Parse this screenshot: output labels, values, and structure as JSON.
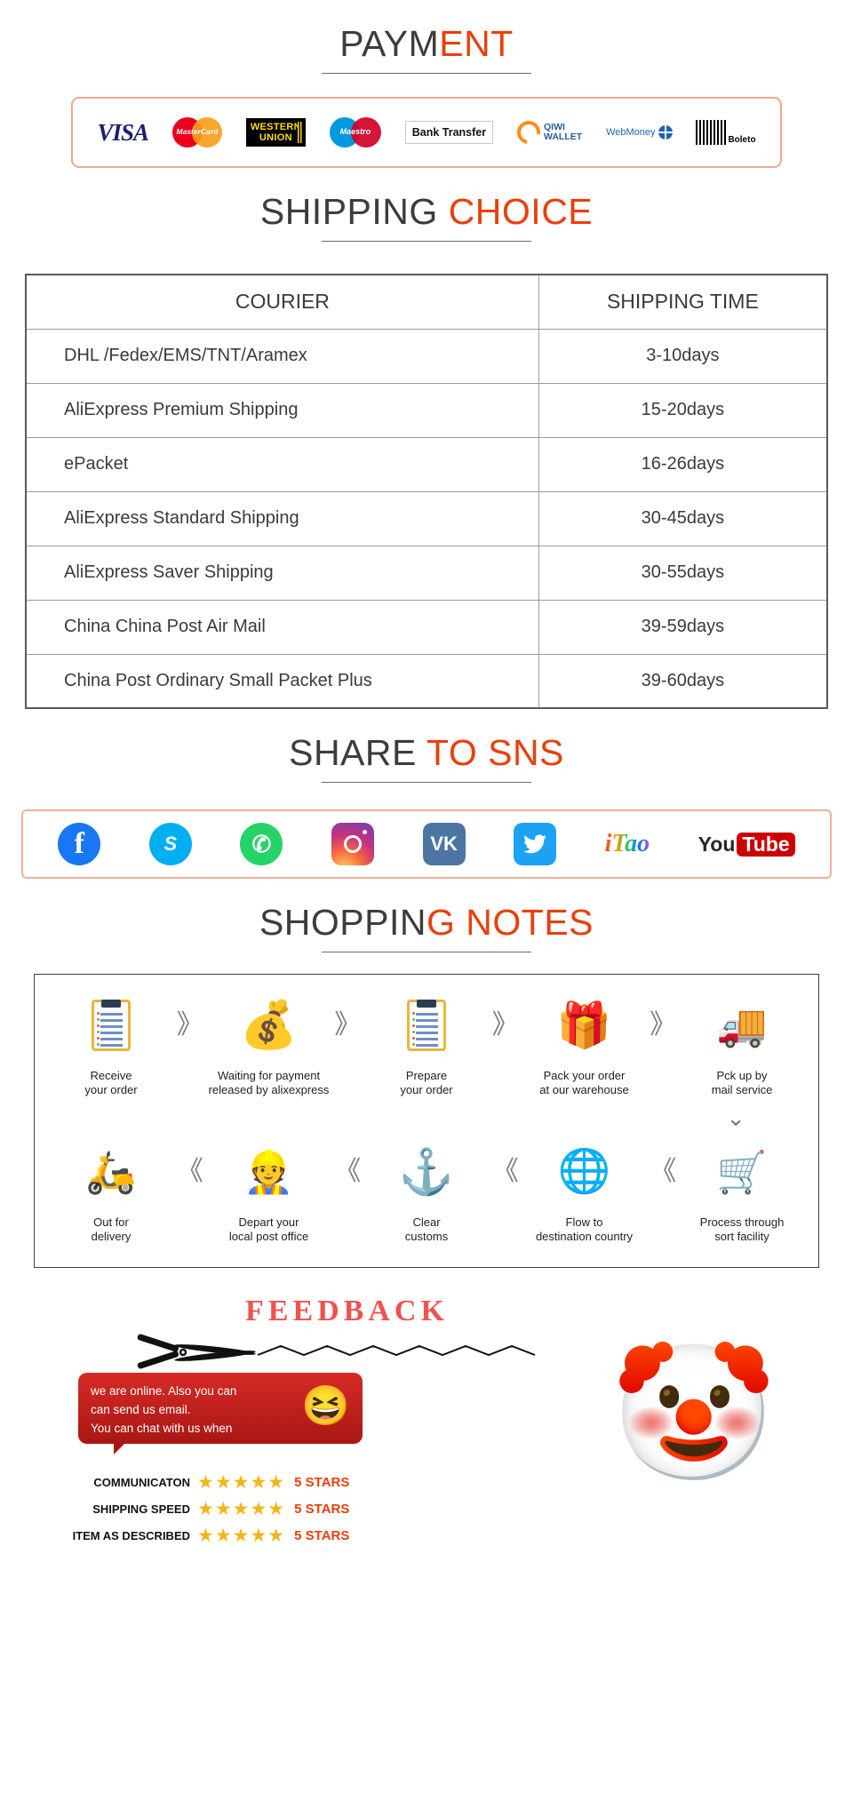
{
  "payment": {
    "heading_dark": "PAYM",
    "heading_red": "ENT",
    "methods": [
      {
        "name": "visa",
        "label": "VISA"
      },
      {
        "name": "mastercard",
        "label": "MasterCard"
      },
      {
        "name": "western-union",
        "line1": "WESTERN",
        "line2": "UNION"
      },
      {
        "name": "maestro",
        "label": "Maestro"
      },
      {
        "name": "bank-transfer",
        "label": "Bank Transfer"
      },
      {
        "name": "qiwi-wallet",
        "line1": "QIWI",
        "line2": "WALLET"
      },
      {
        "name": "webmoney",
        "label": "WebMoney"
      },
      {
        "name": "boleto",
        "label": "Boleto"
      }
    ]
  },
  "shipping": {
    "heading_dark": "SHIPPING",
    "heading_red": "CHOICE",
    "columns": [
      "COURIER",
      "SHIPPING TIME"
    ],
    "rows": [
      {
        "courier": "DHL /Fedex/EMS/TNT/Aramex",
        "time": "3-10days"
      },
      {
        "courier": "AliExpress Premium Shipping",
        "time": "15-20days"
      },
      {
        "courier": "ePacket",
        "time": "16-26days"
      },
      {
        "courier": "AliExpress Standard Shipping",
        "time": "30-45days"
      },
      {
        "courier": "AliExpress Saver Shipping",
        "time": "30-55days"
      },
      {
        "courier": "China China Post Air Mail",
        "time": "39-59days"
      },
      {
        "courier": "China Post Ordinary Small Packet Plus",
        "time": "39-60days"
      }
    ]
  },
  "sns": {
    "heading_dark": "SHARE",
    "heading_red": "TO SNS",
    "items": [
      {
        "name": "facebook",
        "glyph": "f"
      },
      {
        "name": "skype",
        "glyph": "S"
      },
      {
        "name": "whatsapp",
        "glyph": "✆"
      },
      {
        "name": "instagram",
        "glyph": ""
      },
      {
        "name": "vk",
        "glyph": "VK"
      },
      {
        "name": "twitter",
        "glyph": "ᵗ"
      },
      {
        "name": "itao",
        "glyph": "iTao"
      },
      {
        "name": "youtube",
        "part1": "You",
        "part2": "Tube"
      }
    ]
  },
  "notes": {
    "heading_dark": "SHOPPIN",
    "heading_red": "G NOTES",
    "row1": [
      {
        "icon": "clipboard-icon",
        "caption": "Receive\nyour order"
      },
      {
        "icon": "money-bag-icon",
        "caption": "Waiting for payment\nreleased by alixexpress"
      },
      {
        "icon": "clipboard-icon",
        "caption": "Prepare\nyour order"
      },
      {
        "icon": "gift-box-icon",
        "caption": "Pack your order\nat our warehouse"
      },
      {
        "icon": "delivery-truck-icon",
        "caption": "Pck up by\nmail service"
      }
    ],
    "row2": [
      {
        "icon": "scooter-icon",
        "caption": "Out for\ndelivery"
      },
      {
        "icon": "postman-icon",
        "caption": "Depart your\nlocal post office"
      },
      {
        "icon": "anchor-icon",
        "caption": "Clear\ncustoms"
      },
      {
        "icon": "globe-icon",
        "caption": "Flow to\ndestination country"
      },
      {
        "icon": "sorting-cart-icon",
        "caption": "Process through\nsort facility"
      }
    ],
    "arrow_forward": "》",
    "arrow_back": "《",
    "arrow_down": "⌄"
  },
  "feedback": {
    "title": "FEEDBACK",
    "bubble_lines": [
      "we are online. Also you can",
      "can send us email.",
      "You can chat with us when"
    ],
    "ratings": [
      {
        "label": "COMMUNICATON",
        "stars": "★★★★★",
        "value": "5 STARS"
      },
      {
        "label": "SHIPPING SPEED",
        "stars": "★★★★★",
        "value": "5 STARS"
      },
      {
        "label": "ITEM AS DESCRIBED",
        "stars": "★★★★★",
        "value": "5 STARS"
      }
    ]
  },
  "colors": {
    "accent_red": "#e8400c",
    "heading_dark": "#3d3d3d",
    "border_peach": "#f0a88d",
    "star_gold": "#f5b51a"
  }
}
